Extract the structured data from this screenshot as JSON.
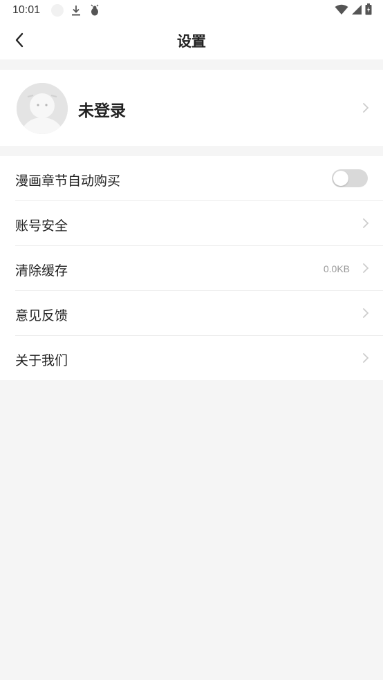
{
  "status_bar": {
    "time": "10:01",
    "icons": [
      "notification-dot-icon",
      "download-icon",
      "bug-icon",
      "wifi-icon",
      "signal-icon",
      "battery-icon"
    ]
  },
  "header": {
    "title": "设置",
    "back_icon": "back-chevron-icon"
  },
  "profile": {
    "name": "未登录",
    "avatar_icon": "default-avatar-icon"
  },
  "settings": {
    "auto_buy": {
      "label": "漫画章节自动购买",
      "enabled": false
    },
    "account_security": {
      "label": "账号安全"
    },
    "clear_cache": {
      "label": "清除缓存",
      "value": "0.0KB"
    },
    "feedback": {
      "label": "意见反馈"
    },
    "about": {
      "label": "关于我们"
    }
  },
  "colors": {
    "background": "#f5f5f5",
    "card": "#ffffff",
    "text_primary": "#222222",
    "text_secondary": "#9a9a9a",
    "toggle_off": "#d9d9d9",
    "chevron": "#cccccc"
  }
}
